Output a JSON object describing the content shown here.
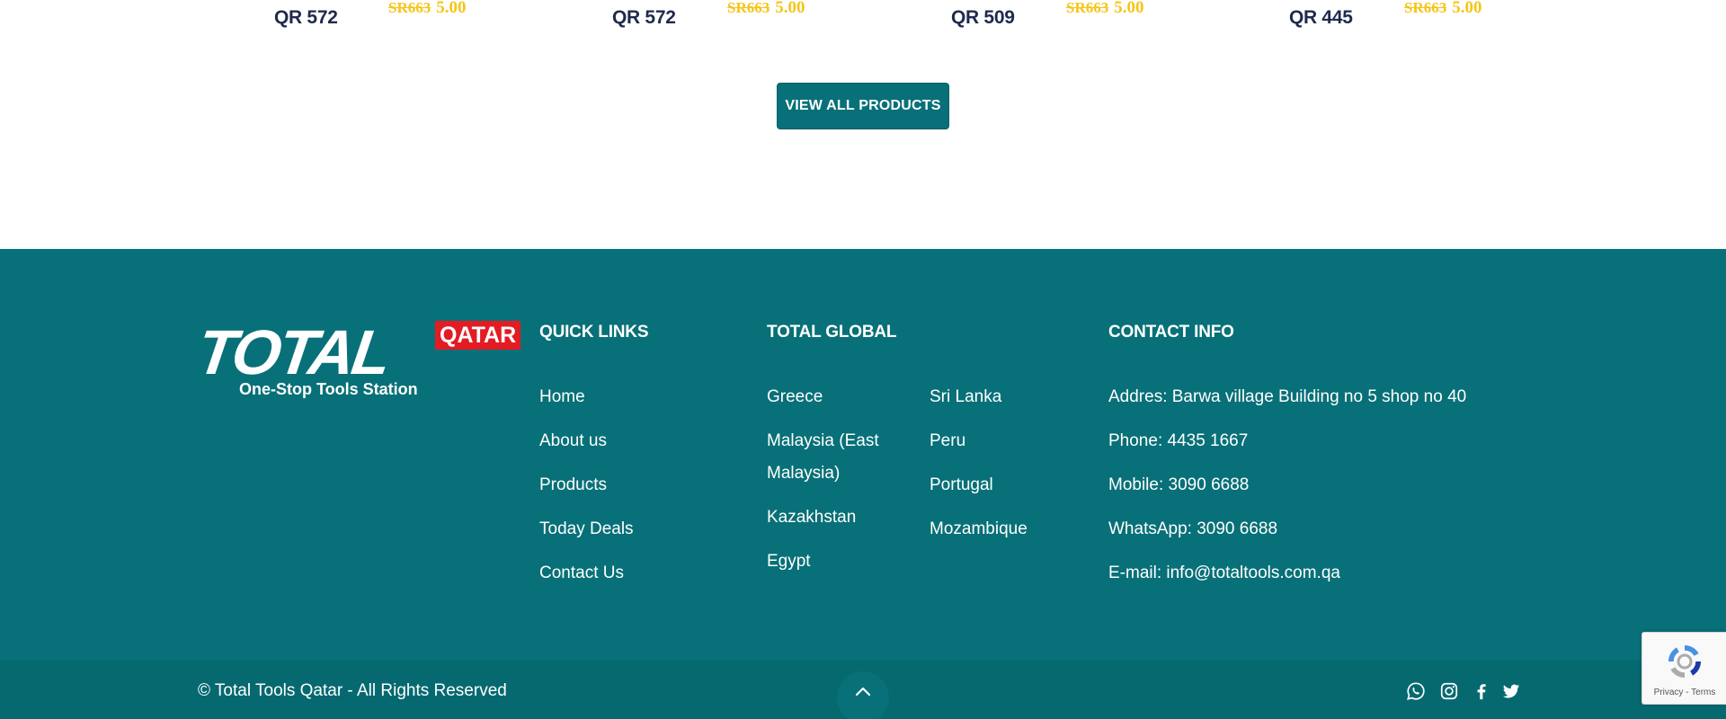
{
  "products": [
    {
      "price": "QR 572",
      "old_price": "SR663",
      "new_price": "5.00"
    },
    {
      "price": "QR 572",
      "old_price": "SR663",
      "new_price": "5.00"
    },
    {
      "price": "QR 509",
      "old_price": "SR663",
      "new_price": "5.00"
    },
    {
      "price": "QR 445",
      "old_price": "SR663",
      "new_price": "5.00"
    }
  ],
  "view_all_label": "VIEW ALL PRODUCTS",
  "footer": {
    "logo": {
      "word": "TOTAL",
      "badge": "QATAR",
      "tagline": "One-Stop Tools Station"
    },
    "quick_links": {
      "title": "QUICK LINKS",
      "items": [
        "Home",
        "About us",
        "Products",
        "Today Deals",
        "Contact Us"
      ]
    },
    "total_global": {
      "title": "TOTAL GLOBAL",
      "col1": [
        "Greece",
        "Malaysia (East Malaysia)",
        "Kazakhstan",
        "Egypt"
      ],
      "col2": [
        "Sri Lanka",
        "Peru",
        "Portugal",
        "Mozambique"
      ]
    },
    "contact_info": {
      "title": "CONTACT INFO",
      "items": [
        "Addres: Barwa village Building no 5 shop no 40",
        "Phone: 4435 1667",
        "Mobile: 3090 6688",
        "WhatsApp: 3090 6688",
        "E-mail: info@totaltools.com.qa"
      ]
    }
  },
  "bottom_bar": {
    "copyright": "© Total Tools Qatar - All Rights Reserved",
    "social": [
      "whatsapp-icon",
      "instagram-icon",
      "facebook-icon",
      "twitter-icon"
    ]
  },
  "recaptcha": {
    "links": "Privacy - Terms"
  },
  "colors": {
    "teal": "#087078",
    "teal_dark": "#066970",
    "gold": "#f5c518",
    "navy": "#1f2a4d",
    "red": "#e31b23"
  }
}
